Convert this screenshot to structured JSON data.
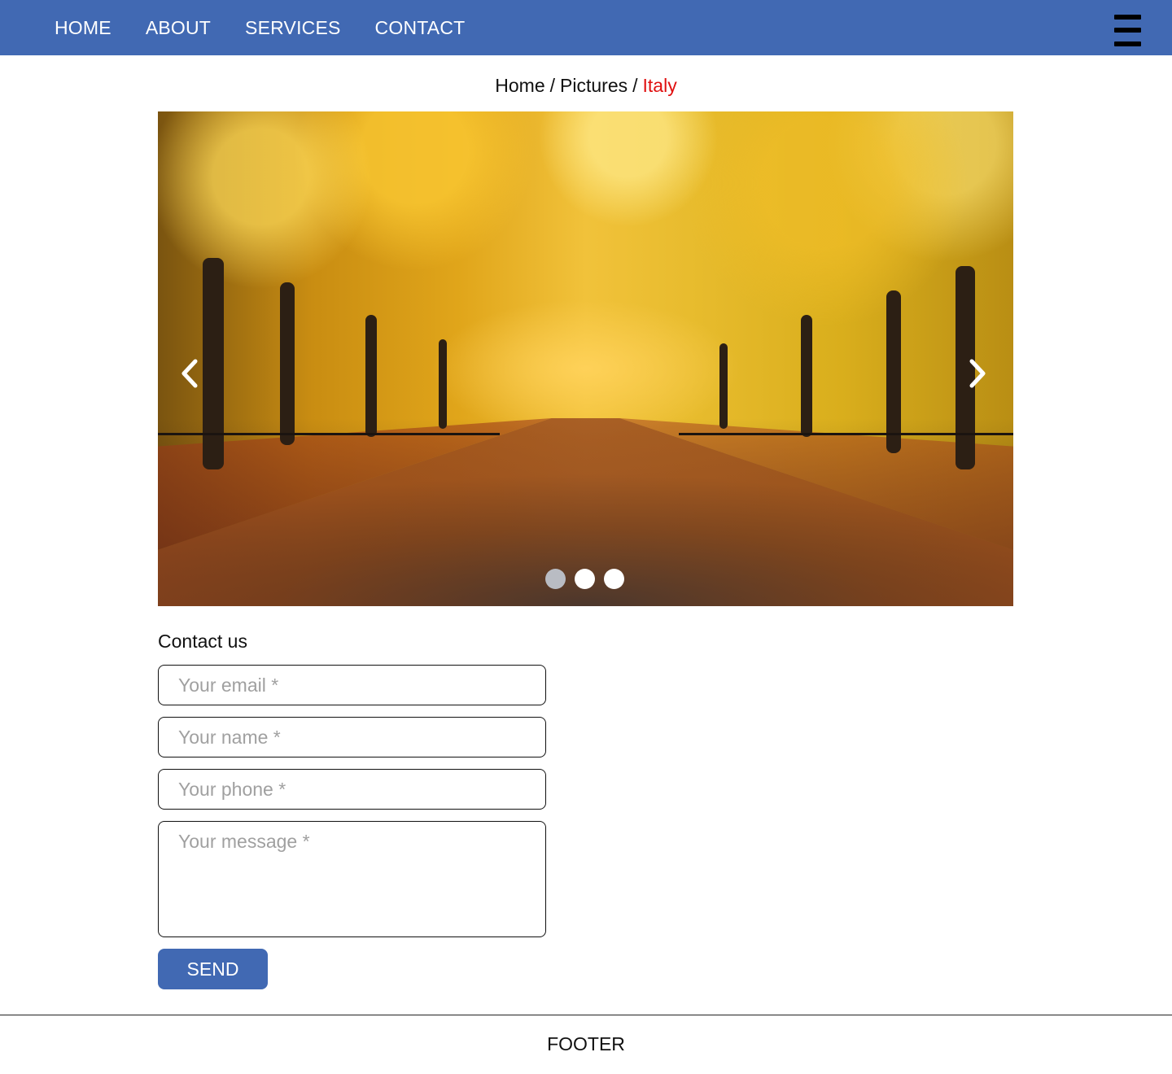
{
  "nav": {
    "links": [
      "HOME",
      "ABOUT",
      "SERVICES",
      "CONTACT"
    ],
    "menu_icon": "hamburger-menu-icon",
    "background_color": "#4169b3"
  },
  "breadcrumb": {
    "items": [
      "Home",
      "Pictures"
    ],
    "separator": "/",
    "current": "Italy",
    "current_color": "#e01010"
  },
  "carousel": {
    "prev_icon": "chevron-left-icon",
    "next_icon": "chevron-right-icon",
    "slide_count": 3,
    "active_index": 0
  },
  "contact": {
    "title": "Contact us",
    "email_placeholder": "Your email *",
    "name_placeholder": "Your name *",
    "phone_placeholder": "Your phone *",
    "message_placeholder": "Your message *",
    "send_label": "SEND",
    "button_color": "#4169b3"
  },
  "footer": {
    "text": "FOOTER"
  }
}
